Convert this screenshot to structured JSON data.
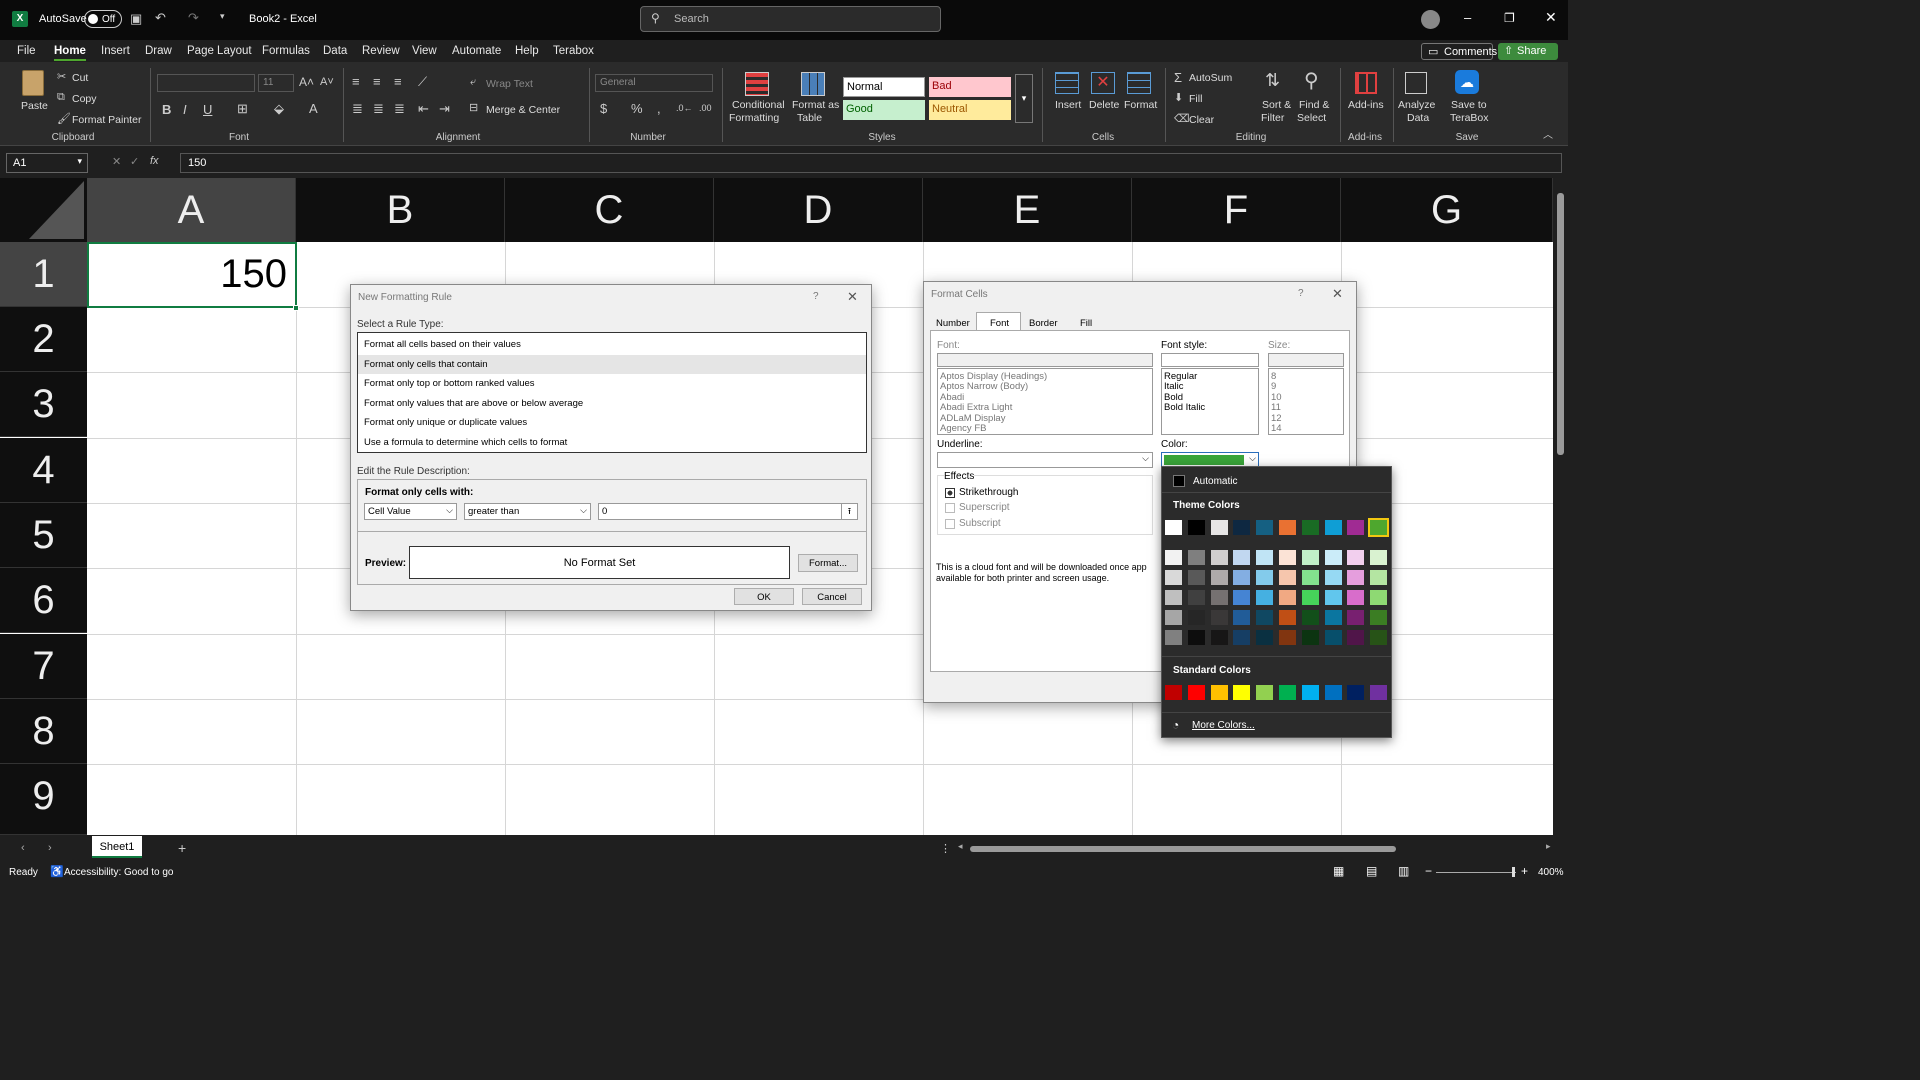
{
  "app": {
    "autosave_label": "AutoSave",
    "autosave_state": "Off",
    "title": "Book2 - Excel",
    "search_placeholder": "Search"
  },
  "menu": [
    "File",
    "Home",
    "Insert",
    "Draw",
    "Page Layout",
    "Formulas",
    "Data",
    "Review",
    "View",
    "Automate",
    "Help",
    "Terabox"
  ],
  "header_buttons": {
    "comments": "Comments",
    "share": "Share"
  },
  "ribbon": {
    "clipboard": {
      "paste": "Paste",
      "cut": "Cut",
      "copy": "Copy",
      "format_painter": "Format Painter",
      "group": "Clipboard"
    },
    "font": {
      "size": "11",
      "group": "Font"
    },
    "alignment": {
      "wrap": "Wrap Text",
      "merge": "Merge & Center",
      "group": "Alignment"
    },
    "number": {
      "format": "General",
      "group": "Number"
    },
    "styles": {
      "cond1": "Conditional",
      "cond2": "Formatting",
      "table1": "Format as",
      "table2": "Table",
      "normal": "Normal",
      "bad": "Bad",
      "good": "Good",
      "neutral": "Neutral",
      "group": "Styles"
    },
    "cells": {
      "insert": "Insert",
      "delete": "Delete",
      "format": "Format",
      "group": "Cells"
    },
    "editing": {
      "autosum": "AutoSum",
      "fill": "Fill",
      "clear": "Clear",
      "sort1": "Sort &",
      "sort2": "Filter",
      "find1": "Find &",
      "find2": "Select",
      "group": "Editing"
    },
    "addins": {
      "label": "Add-ins",
      "group": "Add-ins"
    },
    "analyze": {
      "l1": "Analyze",
      "l2": "Data"
    },
    "save": {
      "l1": "Save to",
      "l2": "TeraBox",
      "group": "Save"
    }
  },
  "formula_bar": {
    "name_box": "A1",
    "fx": "fx",
    "value": "150"
  },
  "columns": [
    "A",
    "B",
    "C",
    "D",
    "E",
    "F",
    "G"
  ],
  "rows": [
    "1",
    "2",
    "3",
    "4",
    "5",
    "6",
    "7",
    "8",
    "9"
  ],
  "cell_a1": "150",
  "new_rule": {
    "title": "New Formatting Rule",
    "help": "?",
    "select_type": "Select a Rule Type:",
    "types": [
      "Format all cells based on their values",
      "Format only cells that contain",
      "Format only top or bottom ranked values",
      "Format only values that are above or below average",
      "Format only unique or duplicate values",
      "Use a formula to determine which cells to format"
    ],
    "edit_desc": "Edit the Rule Description:",
    "format_only": "Format only cells with:",
    "op1": "Cell Value",
    "op2": "greater than",
    "value": "0",
    "preview_label": "Preview:",
    "preview_text": "No Format Set",
    "format_btn": "Format...",
    "ok": "OK",
    "cancel": "Cancel"
  },
  "format_cells": {
    "title": "Format Cells",
    "help": "?",
    "tabs": [
      "Number",
      "Font",
      "Border",
      "Fill"
    ],
    "font_label": "Font:",
    "style_label": "Font style:",
    "size_label": "Size:",
    "fonts": [
      "Aptos Display (Headings)",
      "Aptos Narrow (Body)",
      "Abadi",
      "Abadi Extra Light",
      "ADLaM Display",
      "Agency FB"
    ],
    "styles": [
      "Regular",
      "Italic",
      "Bold",
      "Bold Italic"
    ],
    "sizes": [
      "8",
      "9",
      "10",
      "11",
      "12",
      "14"
    ],
    "underline_label": "Underline:",
    "color_label": "Color:",
    "effects_label": "Effects",
    "strike": "Strikethrough",
    "superscript": "Superscript",
    "subscript": "Subscript",
    "note1": "This is a cloud font and will be downloaded once app",
    "note2": "available for both printer and screen usage.",
    "selected_color": "#3aa53a"
  },
  "color_picker": {
    "automatic": "Automatic",
    "theme_label": "Theme Colors",
    "standard_label": "Standard Colors",
    "more": "More Colors...",
    "theme_top": [
      "#ffffff",
      "#000000",
      "#e7e6e6",
      "#0e2841",
      "#156082",
      "#e97132",
      "#196b24",
      "#0f9ed5",
      "#a02b93",
      "#4ea72e"
    ],
    "theme_shades": [
      [
        "#f2f2f2",
        "#7f7f7f",
        "#d0cece",
        "#c1d7f0",
        "#c0e4f5",
        "#fbe3d6",
        "#c1f0c8",
        "#cbecf9",
        "#f2cfee",
        "#d9f2d0"
      ],
      [
        "#d9d9d9",
        "#595959",
        "#aeaaaa",
        "#83aee2",
        "#83cbeb",
        "#f6c6ad",
        "#83e28e",
        "#96d9f3",
        "#e59edd",
        "#b4e5a2"
      ],
      [
        "#bfbfbf",
        "#404040",
        "#757171",
        "#4584d3",
        "#45b0e1",
        "#f1a983",
        "#46d35a",
        "#61c6ed",
        "#d86dcb",
        "#8ed973"
      ],
      [
        "#a6a6a6",
        "#262626",
        "#3a3838",
        "#215c98",
        "#104862",
        "#c04f15",
        "#124f1a",
        "#0b76a0",
        "#782070",
        "#3b7d23"
      ],
      [
        "#808080",
        "#0d0d0d",
        "#171616",
        "#163e64",
        "#0a3041",
        "#813510",
        "#0c3411",
        "#074f6b",
        "#501549",
        "#275317"
      ]
    ],
    "standard": [
      "#c00000",
      "#ff0000",
      "#ffc000",
      "#ffff00",
      "#92d050",
      "#00b050",
      "#00b0f0",
      "#0070c0",
      "#002060",
      "#7030a0"
    ]
  },
  "sheet_tab": "Sheet1",
  "status": {
    "ready": "Ready",
    "accessibility": "Accessibility: Good to go",
    "zoom": "400%"
  }
}
